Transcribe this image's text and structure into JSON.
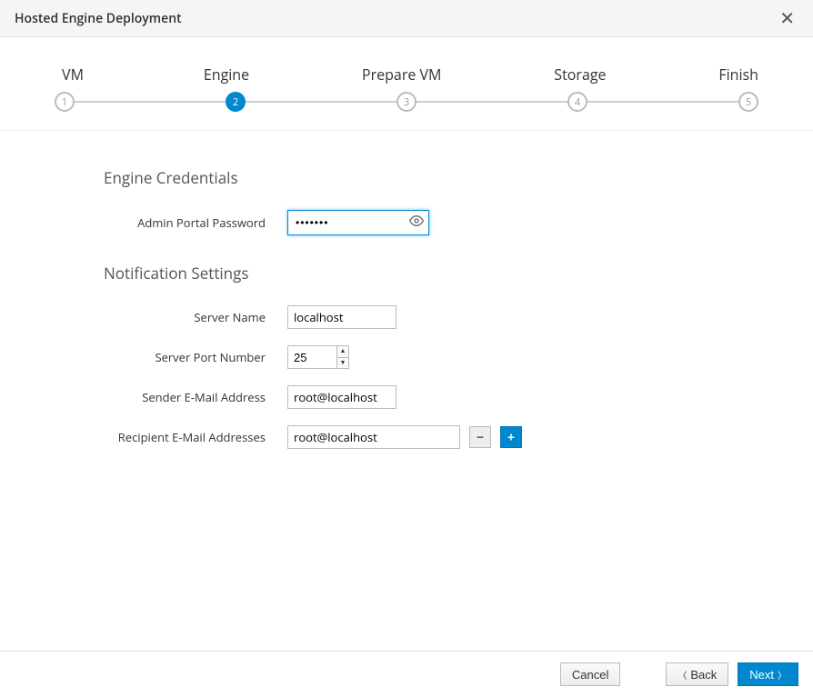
{
  "header": {
    "title": "Hosted Engine Deployment"
  },
  "wizard": {
    "steps": [
      {
        "label": "VM",
        "num": "1",
        "active": false
      },
      {
        "label": "Engine",
        "num": "2",
        "active": true
      },
      {
        "label": "Prepare VM",
        "num": "3",
        "active": false
      },
      {
        "label": "Storage",
        "num": "4",
        "active": false
      },
      {
        "label": "Finish",
        "num": "5",
        "active": false
      }
    ]
  },
  "sections": {
    "credentials": {
      "title": "Engine Credentials",
      "password_label": "Admin Portal Password",
      "password_value": "•••••••"
    },
    "notifications": {
      "title": "Notification Settings",
      "server_name_label": "Server Name",
      "server_name_value": "localhost",
      "server_port_label": "Server Port Number",
      "server_port_value": "25",
      "sender_label": "Sender E-Mail Address",
      "sender_value": "root@localhost",
      "recipients_label": "Recipient E-Mail Addresses",
      "recipients": [
        "root@localhost"
      ]
    }
  },
  "footer": {
    "cancel": "Cancel",
    "back": "Back",
    "next": "Next"
  }
}
